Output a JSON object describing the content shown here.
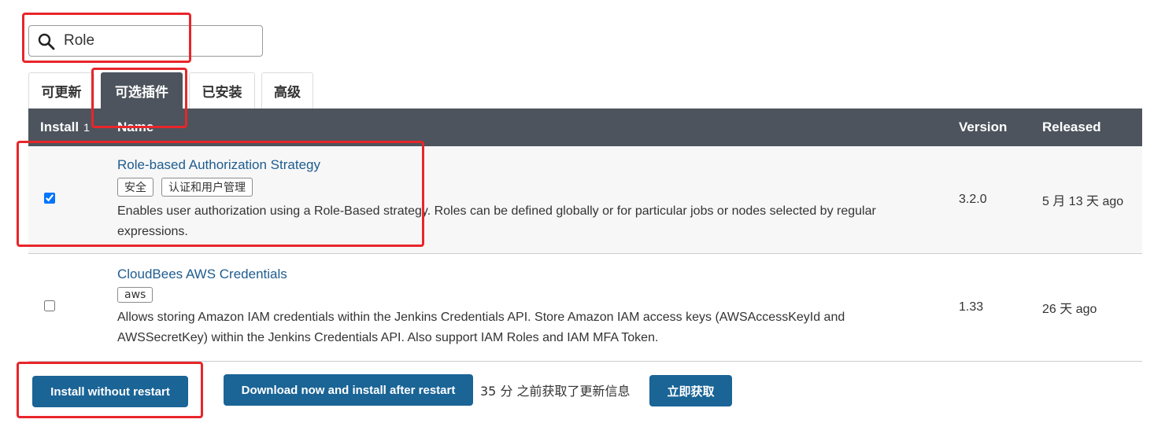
{
  "search": {
    "value": "Role",
    "icon": "search-icon"
  },
  "tabs": [
    {
      "label": "可更新"
    },
    {
      "label": "可选插件",
      "active": true
    },
    {
      "label": "已安装"
    },
    {
      "label": "高级"
    }
  ],
  "table": {
    "headers": {
      "install": "Install",
      "install_count": "1",
      "name": "Name",
      "version": "Version",
      "released": "Released"
    },
    "rows": [
      {
        "checked": true,
        "name": "Role-based Authorization Strategy",
        "tags": [
          "安全",
          "认证和用户管理"
        ],
        "description": "Enables user authorization using a Role-Based strategy. Roles can be defined globally or for particular jobs or nodes selected by regular expressions.",
        "version": "3.2.0",
        "released": "5 月 13 天 ago"
      },
      {
        "checked": false,
        "name": "CloudBees AWS Credentials",
        "tags": [
          "aws"
        ],
        "description": "Allows storing Amazon IAM credentials within the Jenkins Credentials API. Store Amazon IAM access keys (AWSAccessKeyId and AWSSecretKey) within the Jenkins Credentials API. Also support IAM Roles and IAM MFA Token.",
        "version": "1.33",
        "released": "26 天 ago"
      }
    ]
  },
  "footer": {
    "install_without_restart": "Install without restart",
    "download_install_after_restart": "Download now and install after restart",
    "update_info": "35 分 之前获取了更新信息",
    "fetch_now": "立即获取"
  },
  "colors": {
    "header_bg": "#4d545d",
    "button_bg": "#1a6496",
    "link": "#1e5c8f",
    "annotation": "#e8262a"
  }
}
